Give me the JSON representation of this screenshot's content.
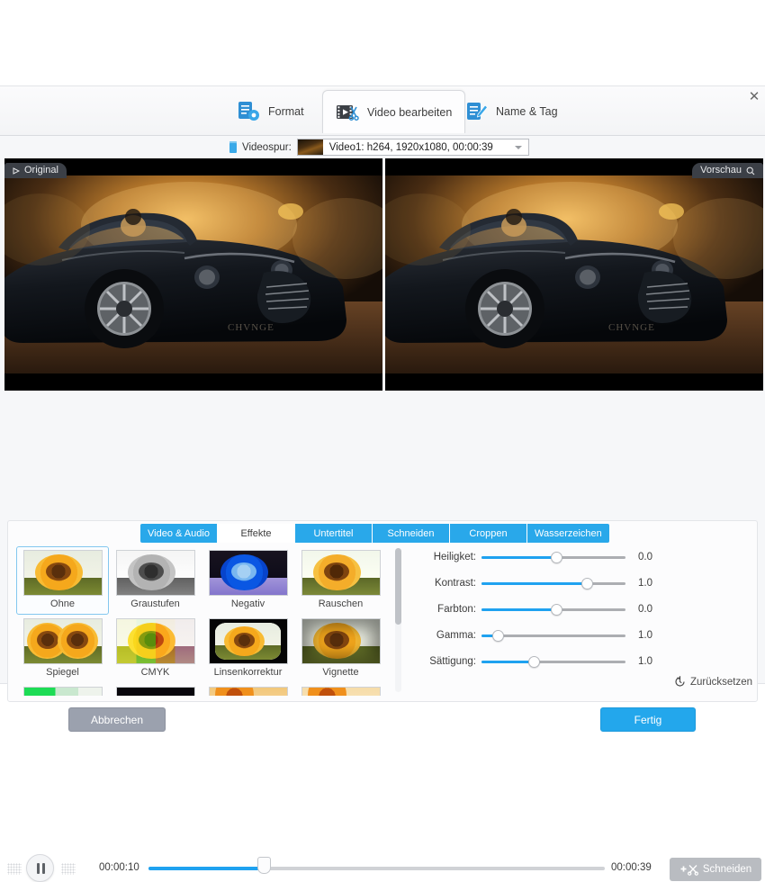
{
  "window": {
    "close_label": "✕"
  },
  "main_tabs": [
    {
      "id": "format",
      "label": "Format",
      "icon": "document-gear-icon",
      "active": false
    },
    {
      "id": "edit",
      "label": "Video bearbeiten",
      "icon": "film-scissors-icon",
      "active": true
    },
    {
      "id": "nametag",
      "label": "Name & Tag",
      "icon": "document-pencil-icon",
      "active": false
    }
  ],
  "track": {
    "icon": "video-track-icon",
    "label": "Videospur:",
    "selected": "Video1: h264, 1920x1080, 00:00:39",
    "caret_icon": "chevron-down-icon"
  },
  "preview": {
    "left_tab": {
      "label": "Original",
      "icon": "play-triangle-icon"
    },
    "right_tab": {
      "label": "Vorschau",
      "icon": "magnifier-icon"
    }
  },
  "transport": {
    "play_icon": "pause-icon",
    "current_time": "00:00:10",
    "total_time": "00:00:39",
    "progress_percent": 25.2,
    "cut_label": "Schneiden",
    "cut_icon": "plus-scissors-icon"
  },
  "sub_tabs": [
    {
      "id": "video_audio",
      "label": "Video & Audio",
      "active": false
    },
    {
      "id": "effekte",
      "label": "Effekte",
      "active": true
    },
    {
      "id": "untertitel",
      "label": "Untertitel",
      "active": false
    },
    {
      "id": "schneiden",
      "label": "Schneiden",
      "active": false
    },
    {
      "id": "croppen",
      "label": "Croppen",
      "active": false
    },
    {
      "id": "wasserzeichen",
      "label": "Wasserzeichen",
      "active": false
    }
  ],
  "effects": [
    {
      "label": "Ohne",
      "style": "none",
      "selected": true
    },
    {
      "label": "Graustufen",
      "style": "gray",
      "selected": false
    },
    {
      "label": "Negativ",
      "style": "neg",
      "selected": false
    },
    {
      "label": "Rauschen",
      "style": "noise",
      "selected": false
    },
    {
      "label": "Spiegel",
      "style": "mirror",
      "selected": false
    },
    {
      "label": "CMYK",
      "style": "cmyk",
      "selected": false
    },
    {
      "label": "Linsenkorrektur",
      "style": "lens",
      "selected": false
    },
    {
      "label": "Vignette",
      "style": "vign",
      "selected": false
    },
    {
      "label": "",
      "style": "green",
      "selected": false
    },
    {
      "label": "",
      "style": "dark",
      "selected": false
    },
    {
      "label": "",
      "style": "warm",
      "selected": false
    },
    {
      "label": "",
      "style": "warm2",
      "selected": false
    }
  ],
  "sliders": [
    {
      "name": "Heiligket:",
      "value": "0.0",
      "percent": 52
    },
    {
      "name": "Kontrast:",
      "value": "1.0",
      "percent": 73
    },
    {
      "name": "Farbton:",
      "value": "0.0",
      "percent": 52
    },
    {
      "name": "Gamma:",
      "value": "1.0",
      "percent": 11
    },
    {
      "name": "Sättigung:",
      "value": "1.0",
      "percent": 36
    }
  ],
  "reset": {
    "label": "Zurücksetzen",
    "icon": "undo-clock-icon"
  },
  "footer": {
    "cancel_label": "Abbrechen",
    "done_label": "Fertig"
  },
  "colors": {
    "accent": "#29a8ea",
    "seek": "#1fa2f0",
    "cut_button": "#b9bcc1",
    "cancel_button": "#9ba1ae"
  }
}
